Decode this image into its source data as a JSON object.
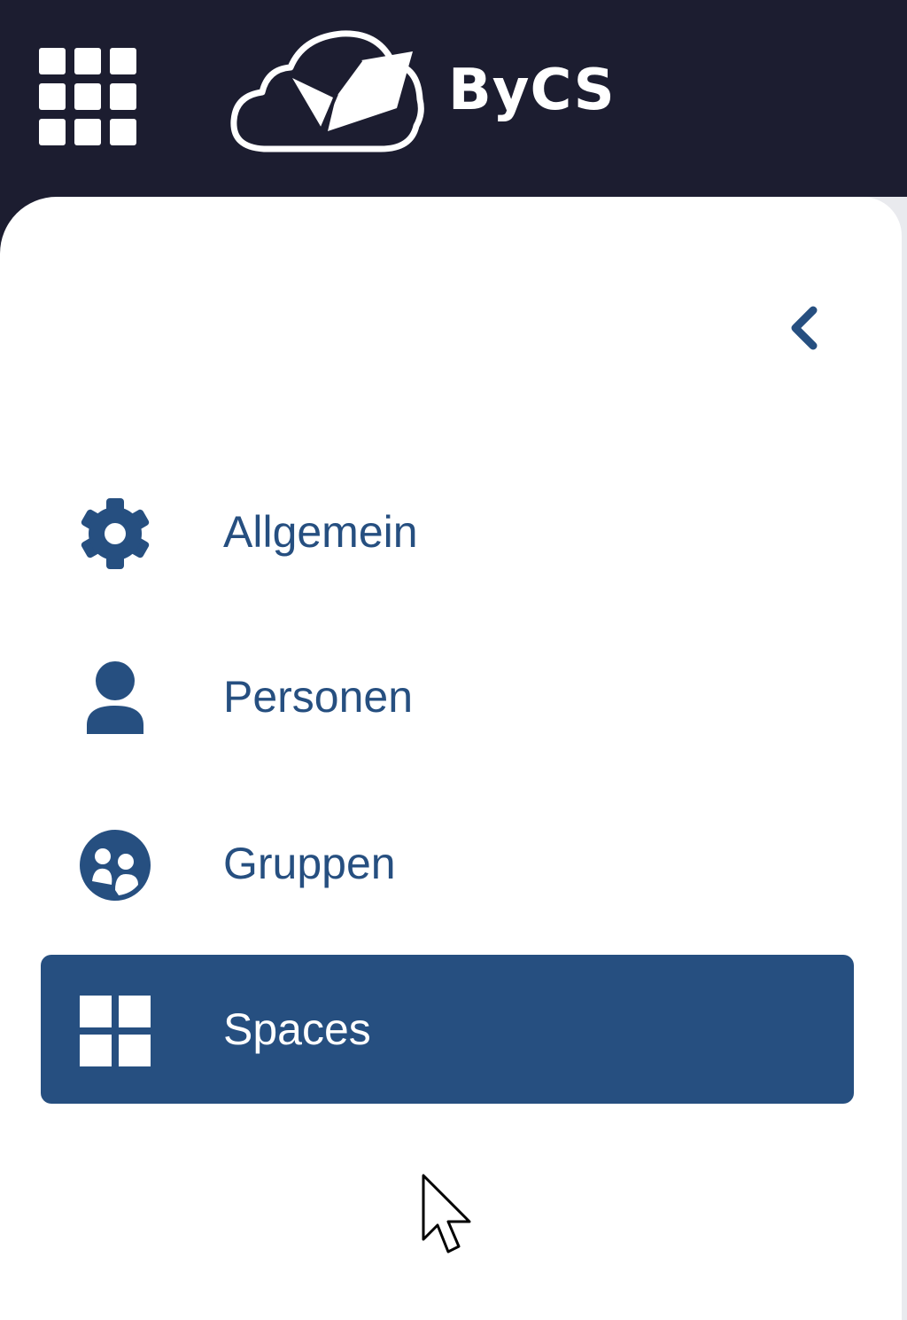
{
  "header": {
    "brand_name": "ByCS",
    "apps_icon": "grid-apps-icon",
    "logo_icon": "cloud-book-logo-icon"
  },
  "sidebar": {
    "collapse_icon": "chevron-left-icon",
    "items": [
      {
        "label": "Allgemein",
        "icon": "gear-icon",
        "active": false
      },
      {
        "label": "Personen",
        "icon": "person-icon",
        "active": false
      },
      {
        "label": "Gruppen",
        "icon": "group-icon",
        "active": false
      },
      {
        "label": "Spaces",
        "icon": "spaces-grid-icon",
        "active": true
      }
    ]
  },
  "colors": {
    "header_bg": "#1c1d30",
    "accent": "#264f80",
    "panel_bg": "#ffffff"
  }
}
